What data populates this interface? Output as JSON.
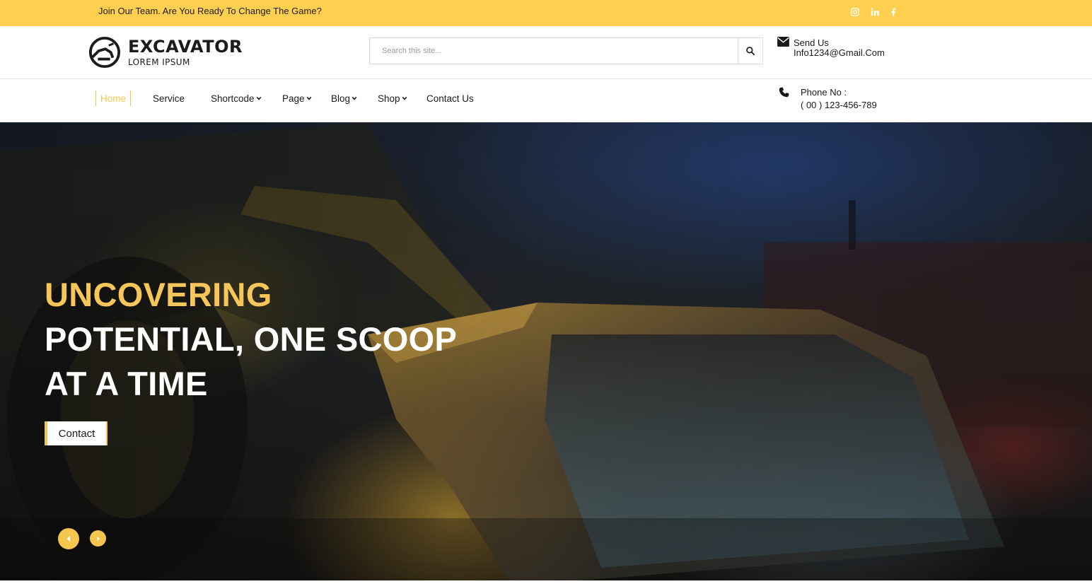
{
  "topbar": {
    "tagline": "Join Our Team. Are You Ready To Change The Game?",
    "social": [
      "instagram-icon",
      "linkedin-icon",
      "facebook-icon"
    ],
    "background": "#ffd04f"
  },
  "brand": {
    "name": "EXCAVATOR",
    "subtitle": "LOREM IPSUM"
  },
  "search": {
    "placeholder": "Search this site...",
    "button_icon": "search-icon"
  },
  "contact": {
    "email_label": "Send Us",
    "email_value": "Info1234@Gmail.Com",
    "phone_label": "Phone No :",
    "phone_value": "( 00 ) 123-456-789"
  },
  "nav": {
    "items": [
      {
        "label": "Home",
        "active": true
      },
      {
        "label": "Service"
      },
      {
        "label": "Shortcode",
        "dropdown": true
      },
      {
        "label": "Page",
        "dropdown": true
      },
      {
        "label": "Blog",
        "dropdown": true
      },
      {
        "label": "Shop",
        "dropdown": true
      },
      {
        "label": "Contact Us"
      }
    ]
  },
  "hero": {
    "title_line1": "UNCOVERING",
    "title_line2": "POTENTIAL, ONE SCOOP",
    "title_line3": "AT A TIME",
    "button_label": "Contact",
    "accent": "#f4c64e"
  }
}
